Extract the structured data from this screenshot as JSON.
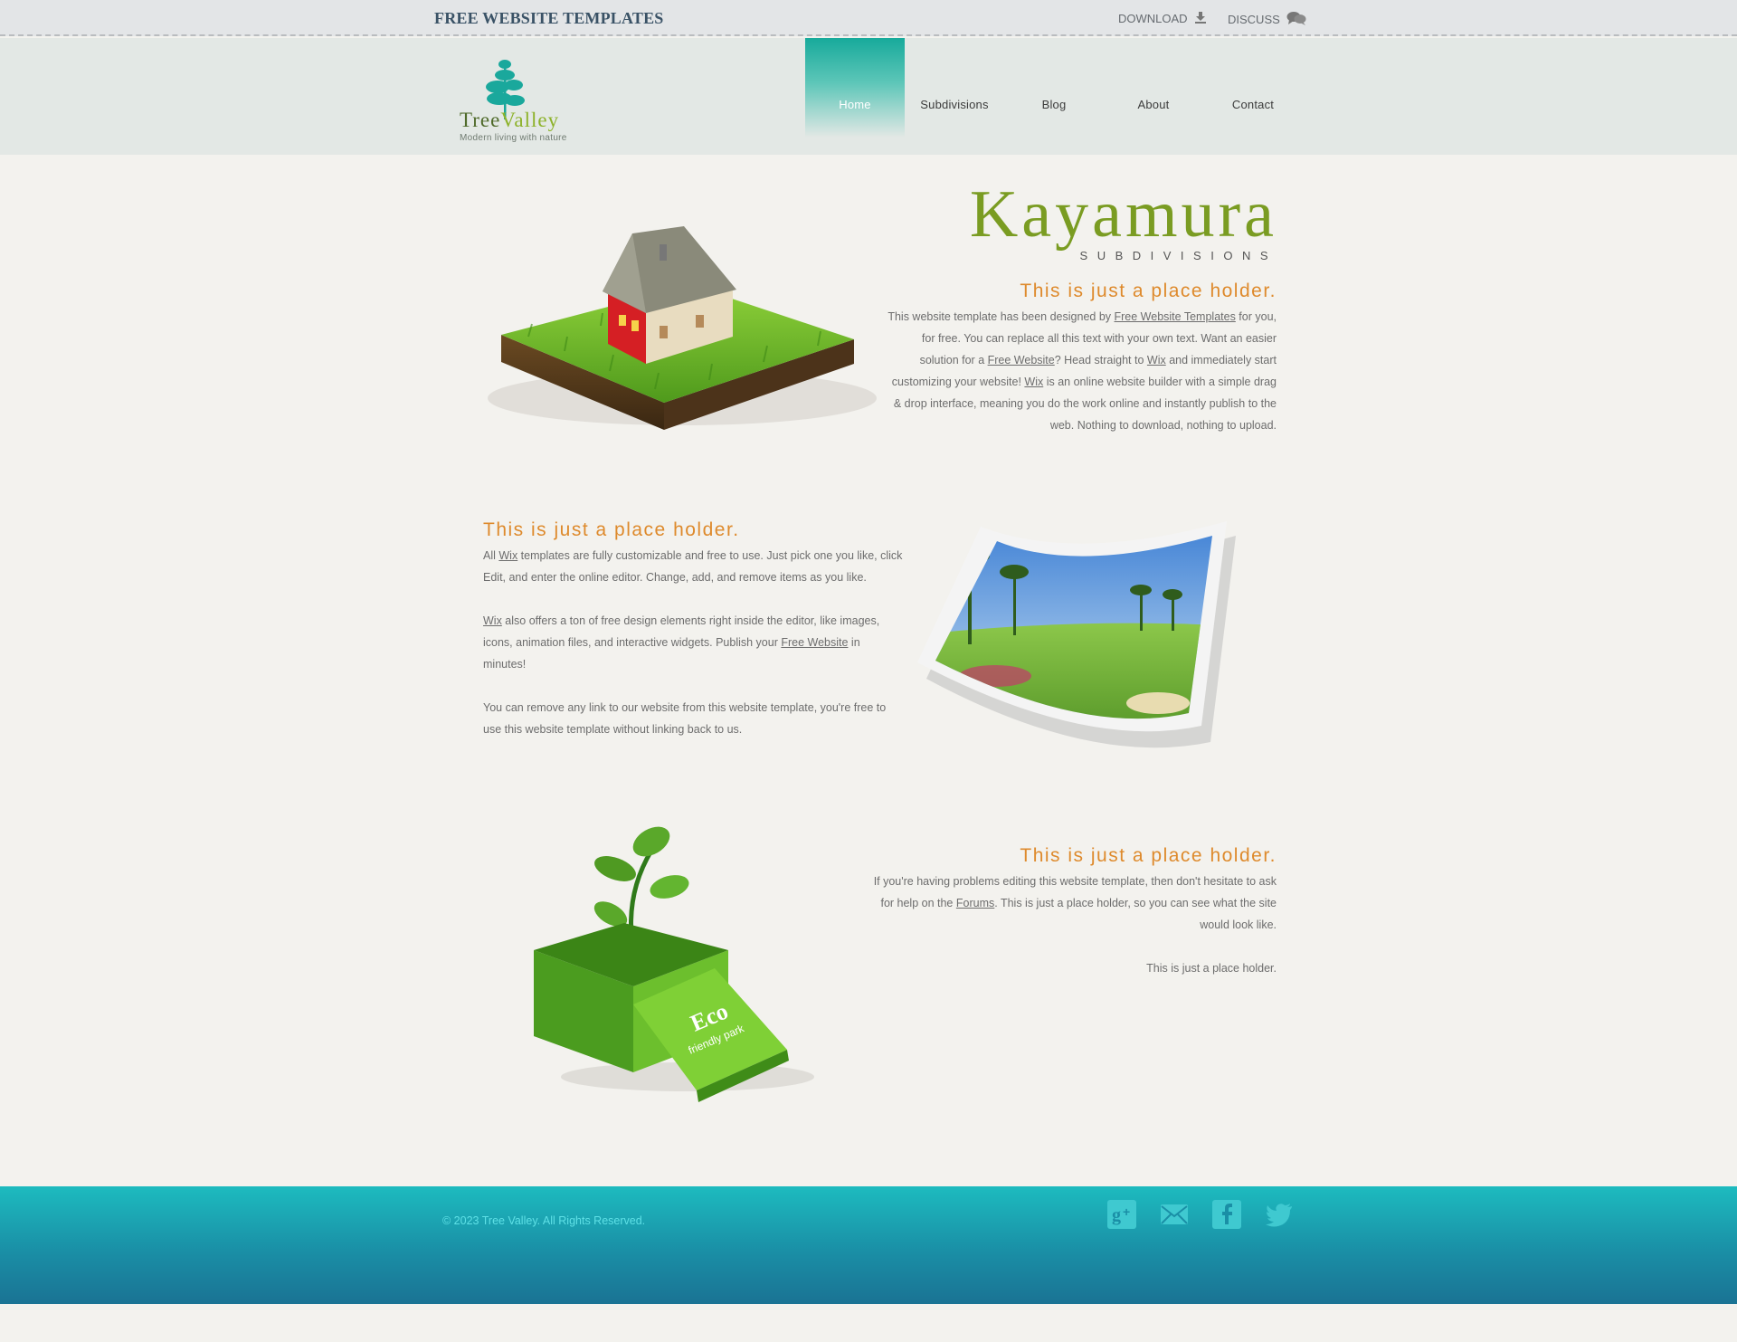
{
  "topbar": {
    "brand": "FREE WEBSITE TEMPLATES",
    "download_label": "DOWNLOAD",
    "download_icon": "download-arrow-icon",
    "discuss_label": "DISCUSS",
    "discuss_icon": "speech-bubbles-icon"
  },
  "logo": {
    "name_part1": "Tree",
    "name_part2": "Valley",
    "tagline": "Modern living with nature",
    "icon": "tree-icon"
  },
  "nav": {
    "items": [
      {
        "label": "Home",
        "active": true
      },
      {
        "label": "Subdivisions",
        "active": false
      },
      {
        "label": "Blog",
        "active": false
      },
      {
        "label": "About",
        "active": false
      },
      {
        "label": "Contact",
        "active": false
      }
    ]
  },
  "hero": {
    "title": "Kayamura",
    "subtitle": "SUBDIVISIONS"
  },
  "section1": {
    "heading": "This is just a place holder.",
    "text_a": "This website template has been designed by ",
    "link_fwt": "Free Website Templates",
    "text_b": " for you, for free. You can replace all this text with your own text. Want an easier solution for a ",
    "link_fw": "Free Website",
    "text_c": "? Head straight to ",
    "link_wix1": "Wix",
    "text_d": " and immediately start customizing your website! ",
    "link_wix2": "Wix",
    "text_e": " is an online website builder with a simple drag & drop interface, meaning you do the work online and instantly publish to the web. Nothing to download, nothing to upload."
  },
  "section2": {
    "heading": "This is just a place holder.",
    "p1_a": "All ",
    "p1_link": "Wix",
    "p1_b": " templates are fully customizable and free to use. Just pick one you like, click Edit, and enter the online editor. Change, add, and remove items as you like.",
    "p2_link1": "Wix",
    "p2_a": " also offers a ton of free design elements right inside the editor, like images, icons, animation files, and interactive widgets. Publish your ",
    "p2_link2": "Free Website",
    "p2_b": " in minutes!",
    "p3": "You can remove any link to our website from this website template, you're free to use this website template without linking back to us."
  },
  "section3": {
    "heading": "This is just a place holder.",
    "p1_a": "If you're having problems editing this website template, then don't hesitate to ask for help on the ",
    "p1_link": "Forums",
    "p1_b": ". This is just a place holder, so you can see what the site would look like.",
    "p2": "This is just a place holder."
  },
  "images": {
    "house": "house-on-grass-image",
    "photo": "golf-course-photo",
    "box": "eco-box-plant-image",
    "box_text1": "Eco",
    "box_text2": "friendly park"
  },
  "footer": {
    "copyright": "© 2023 Tree Valley. All Rights Reserved.",
    "social": [
      "google-plus-icon",
      "mail-icon",
      "facebook-icon",
      "twitter-icon"
    ]
  },
  "colors": {
    "accent_teal": "#17aa9b",
    "heading_orange": "#de8a2c",
    "title_green": "#7a9c22",
    "footer_teal": "#1a8fa6"
  }
}
